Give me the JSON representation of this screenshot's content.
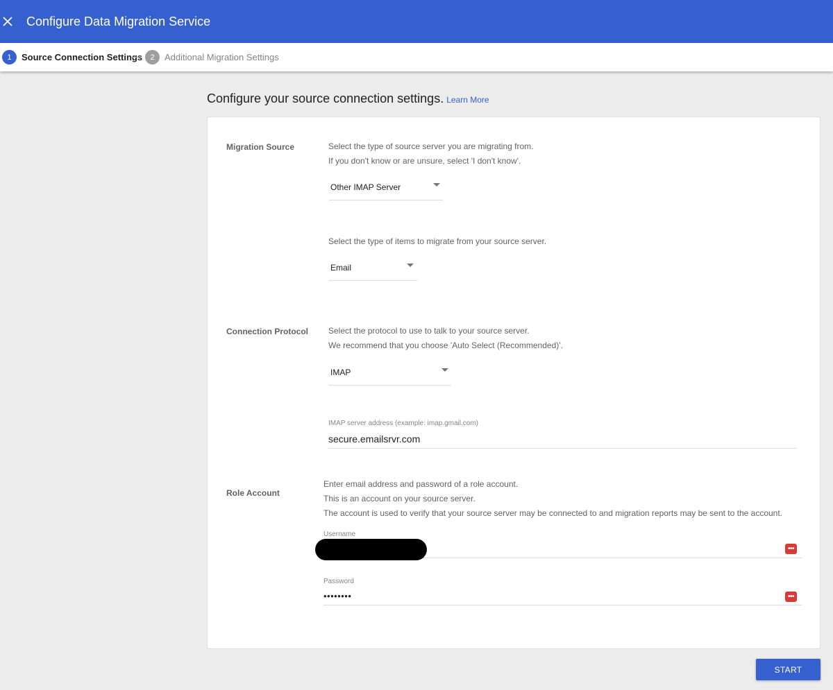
{
  "window": {
    "title": "Configure Data Migration Service",
    "close_icon": "close-icon"
  },
  "stepper": {
    "steps": [
      {
        "number": "1",
        "label": "Source Connection Settings",
        "state": "active"
      },
      {
        "number": "2",
        "label": "Additional Migration Settings",
        "state": "inactive"
      }
    ]
  },
  "main": {
    "heading": "Configure your source connection settings.",
    "learn_more": "Learn More"
  },
  "migration_source": {
    "label": "Migration Source",
    "desc_line1": "Select the type of source server you are migrating from.",
    "desc_line2": "If you don't know or are unsure, select 'I don't know'.",
    "server_select_value": "Other IMAP Server",
    "items_desc": "Select the type of items to migrate from your source server.",
    "items_select_value": "Email"
  },
  "connection_protocol": {
    "label": "Connection Protocol",
    "desc_line1": "Select the protocol to use to talk to your source server.",
    "desc_line2": "We recommend that you choose 'Auto Select (Recommended)'.",
    "protocol_select_value": "IMAP",
    "server_address_label": "IMAP server address (example: imap.gmail.com)",
    "server_address_value": "secure.emailsrvr.com"
  },
  "role_account": {
    "label": "Role Account",
    "desc_line1": "Enter email address and password of a role account.",
    "desc_line2": "This is an account on your source server.",
    "desc_line3": "The account is used to verify that your source server may be connected to and migration reports may be sent to the account.",
    "username_label": "Username",
    "username_value": "",
    "password_label": "Password",
    "password_value": "••••••••"
  },
  "footer": {
    "start_label": "START"
  },
  "colors": {
    "accent": "#3660d0",
    "background": "#ececec",
    "inactive_step": "#9e9e9e",
    "password_manager_icon": "#d93a35"
  }
}
